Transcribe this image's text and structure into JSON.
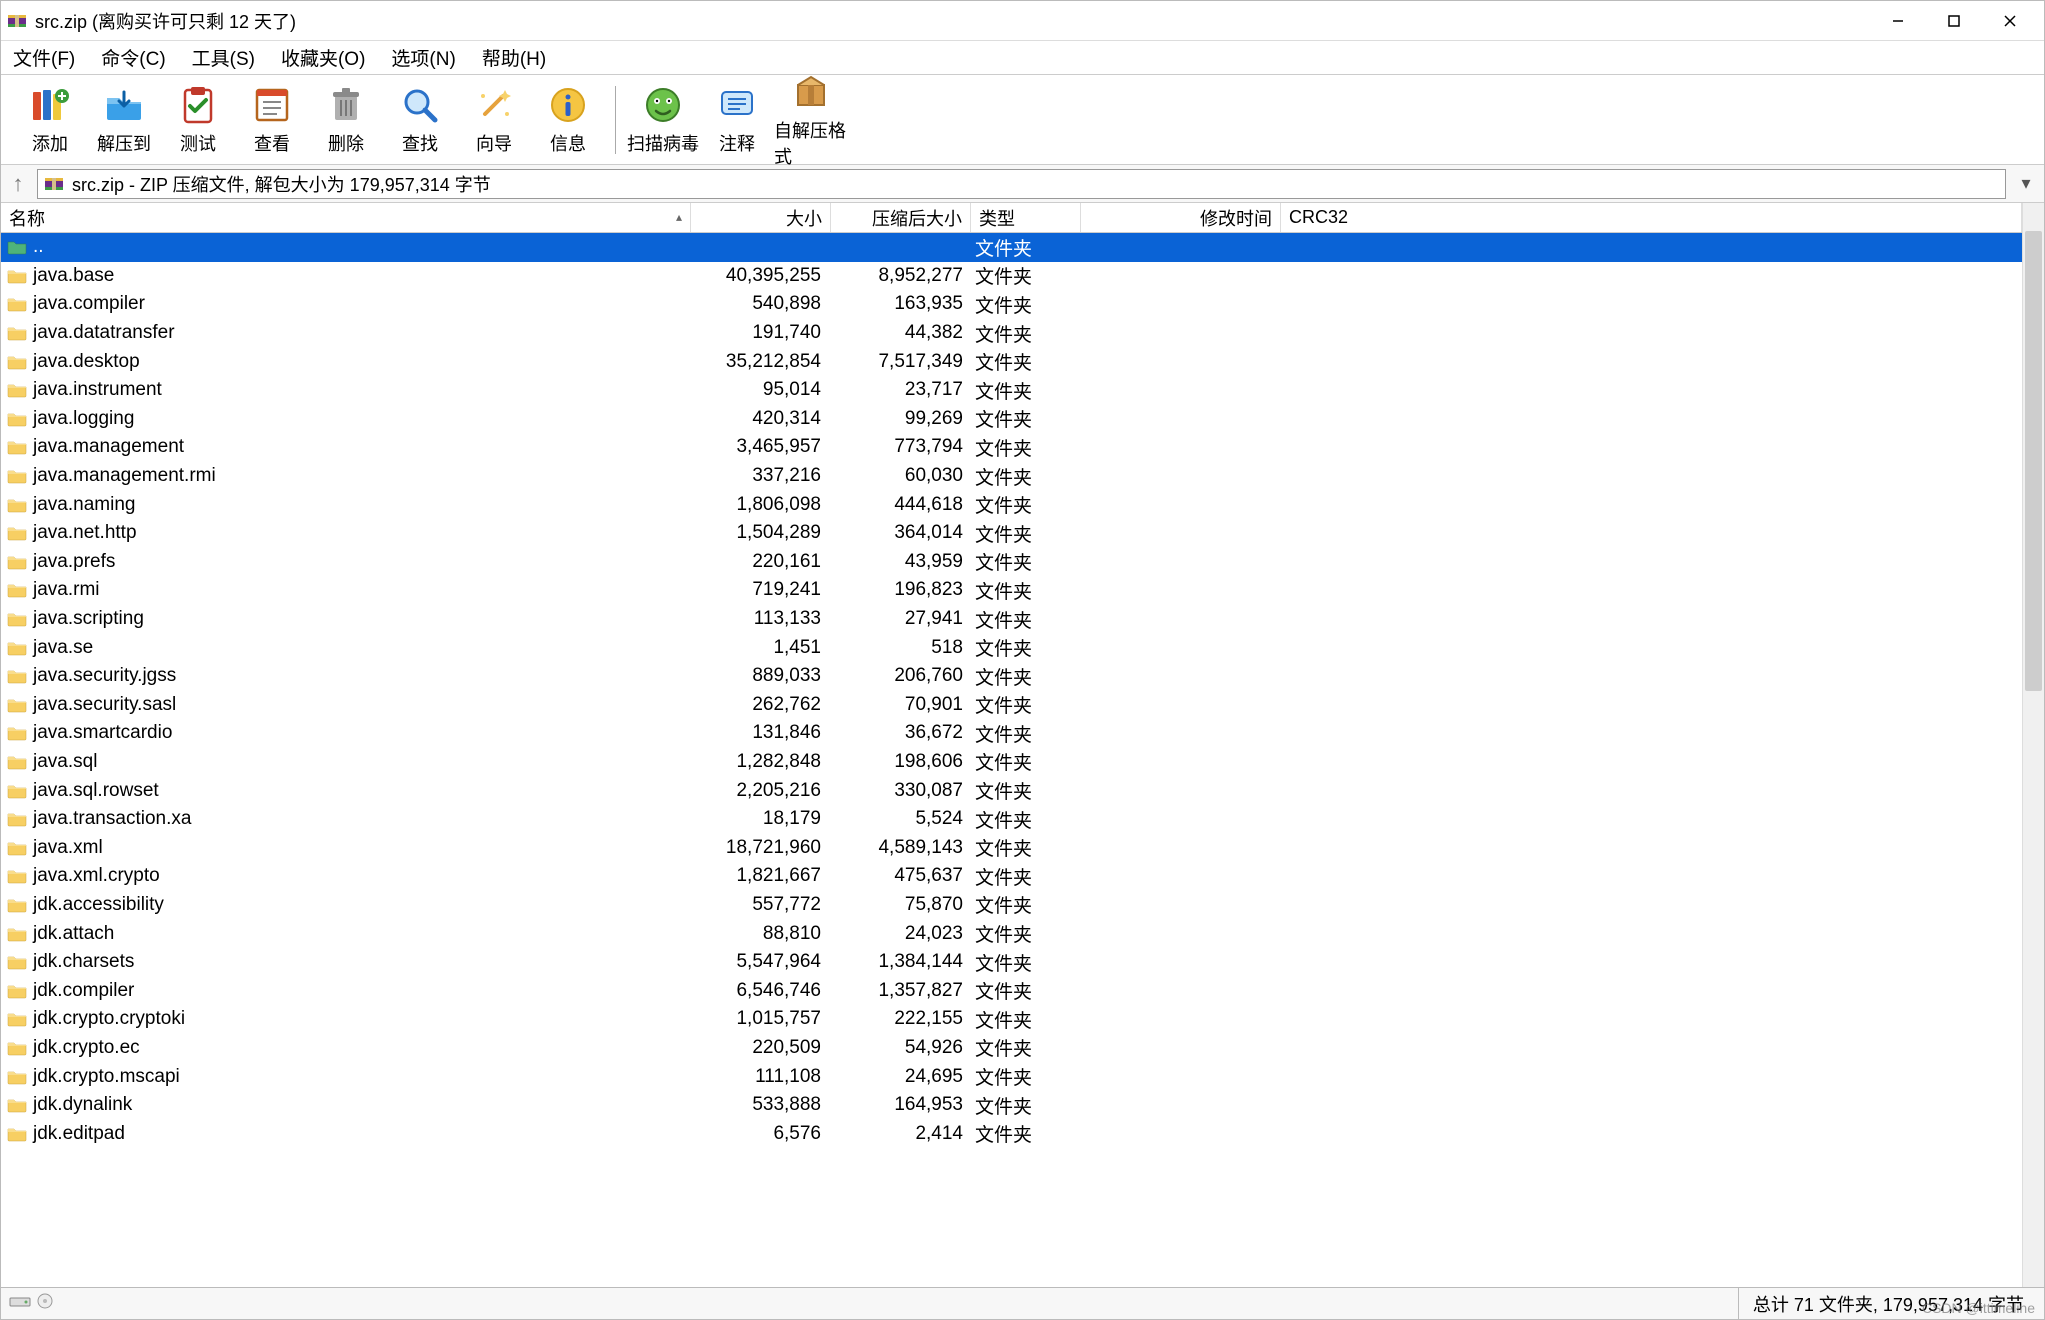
{
  "titlebar": {
    "title": "src.zip (离购买许可只剩 12 天了)"
  },
  "menu": {
    "file": "文件(F)",
    "command": "命令(C)",
    "tools": "工具(S)",
    "favorites": "收藏夹(O)",
    "options": "选项(N)",
    "help": "帮助(H)"
  },
  "toolbar": {
    "add": "添加",
    "extract_to": "解压到",
    "test": "测试",
    "view": "查看",
    "delete": "删除",
    "find": "查找",
    "wizard": "向导",
    "info": "信息",
    "scan_virus": "扫描病毒",
    "comment": "注释",
    "sfx": "自解压格式"
  },
  "pathbar": {
    "text": "src.zip - ZIP 压缩文件, 解包大小为 179,957,314 字节"
  },
  "headers": {
    "name": "名称",
    "size": "大小",
    "packed": "压缩后大小",
    "type": "类型",
    "mtime": "修改时间",
    "crc": "CRC32"
  },
  "rows": [
    {
      "name": "..",
      "size": "",
      "packed": "",
      "type": "文件夹",
      "updir": true
    },
    {
      "name": "java.base",
      "size": "40,395,255",
      "packed": "8,952,277",
      "type": "文件夹"
    },
    {
      "name": "java.compiler",
      "size": "540,898",
      "packed": "163,935",
      "type": "文件夹"
    },
    {
      "name": "java.datatransfer",
      "size": "191,740",
      "packed": "44,382",
      "type": "文件夹"
    },
    {
      "name": "java.desktop",
      "size": "35,212,854",
      "packed": "7,517,349",
      "type": "文件夹"
    },
    {
      "name": "java.instrument",
      "size": "95,014",
      "packed": "23,717",
      "type": "文件夹"
    },
    {
      "name": "java.logging",
      "size": "420,314",
      "packed": "99,269",
      "type": "文件夹"
    },
    {
      "name": "java.management",
      "size": "3,465,957",
      "packed": "773,794",
      "type": "文件夹"
    },
    {
      "name": "java.management.rmi",
      "size": "337,216",
      "packed": "60,030",
      "type": "文件夹"
    },
    {
      "name": "java.naming",
      "size": "1,806,098",
      "packed": "444,618",
      "type": "文件夹"
    },
    {
      "name": "java.net.http",
      "size": "1,504,289",
      "packed": "364,014",
      "type": "文件夹"
    },
    {
      "name": "java.prefs",
      "size": "220,161",
      "packed": "43,959",
      "type": "文件夹"
    },
    {
      "name": "java.rmi",
      "size": "719,241",
      "packed": "196,823",
      "type": "文件夹"
    },
    {
      "name": "java.scripting",
      "size": "113,133",
      "packed": "27,941",
      "type": "文件夹"
    },
    {
      "name": "java.se",
      "size": "1,451",
      "packed": "518",
      "type": "文件夹"
    },
    {
      "name": "java.security.jgss",
      "size": "889,033",
      "packed": "206,760",
      "type": "文件夹"
    },
    {
      "name": "java.security.sasl",
      "size": "262,762",
      "packed": "70,901",
      "type": "文件夹"
    },
    {
      "name": "java.smartcardio",
      "size": "131,846",
      "packed": "36,672",
      "type": "文件夹"
    },
    {
      "name": "java.sql",
      "size": "1,282,848",
      "packed": "198,606",
      "type": "文件夹"
    },
    {
      "name": "java.sql.rowset",
      "size": "2,205,216",
      "packed": "330,087",
      "type": "文件夹"
    },
    {
      "name": "java.transaction.xa",
      "size": "18,179",
      "packed": "5,524",
      "type": "文件夹"
    },
    {
      "name": "java.xml",
      "size": "18,721,960",
      "packed": "4,589,143",
      "type": "文件夹"
    },
    {
      "name": "java.xml.crypto",
      "size": "1,821,667",
      "packed": "475,637",
      "type": "文件夹"
    },
    {
      "name": "jdk.accessibility",
      "size": "557,772",
      "packed": "75,870",
      "type": "文件夹"
    },
    {
      "name": "jdk.attach",
      "size": "88,810",
      "packed": "24,023",
      "type": "文件夹"
    },
    {
      "name": "jdk.charsets",
      "size": "5,547,964",
      "packed": "1,384,144",
      "type": "文件夹"
    },
    {
      "name": "jdk.compiler",
      "size": "6,546,746",
      "packed": "1,357,827",
      "type": "文件夹"
    },
    {
      "name": "jdk.crypto.cryptoki",
      "size": "1,015,757",
      "packed": "222,155",
      "type": "文件夹"
    },
    {
      "name": "jdk.crypto.ec",
      "size": "220,509",
      "packed": "54,926",
      "type": "文件夹"
    },
    {
      "name": "jdk.crypto.mscapi",
      "size": "111,108",
      "packed": "24,695",
      "type": "文件夹"
    },
    {
      "name": "jdk.dynalink",
      "size": "533,888",
      "packed": "164,953",
      "type": "文件夹"
    },
    {
      "name": "jdk.editpad",
      "size": "6,576",
      "packed": "2,414",
      "type": "文件夹"
    }
  ],
  "statusbar": {
    "summary": "总计 71 文件夹, 179,957,314 字节"
  },
  "watermark": "CSDN @ittimeline"
}
